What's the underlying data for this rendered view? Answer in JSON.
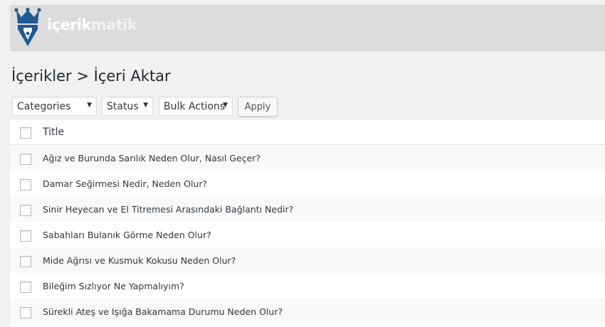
{
  "brand": {
    "part1": "içerik",
    "part2": "matik"
  },
  "page": {
    "title": "İçerikler > İçeri Aktar"
  },
  "filters": {
    "categories": "Categories",
    "status": "Status",
    "bulk_actions": "Bulk Actions",
    "apply": "Apply"
  },
  "table": {
    "header": "Title",
    "rows": [
      "Ağız ve Burunda Sarılık Neden Olur, Nasıl Geçer?",
      "Damar Seğirmesi Nedir, Neden Olur?",
      "Sinir Heyecan ve El Titremesi Arasındaki Bağlantı Nedir?",
      "Sabahları Bulanık Görme Neden Olur?",
      "Mide Ağrısı ve Kusmuk Kokusu Neden Olur?",
      "Bileğim Sızlıyor Ne Yapmalıyım?",
      "Sürekli Ateş ve Işığa Bakamama Durumu Neden Olur?"
    ]
  },
  "colors": {
    "accent": "#1e5a93",
    "header_bg": "#dcdcdc"
  }
}
